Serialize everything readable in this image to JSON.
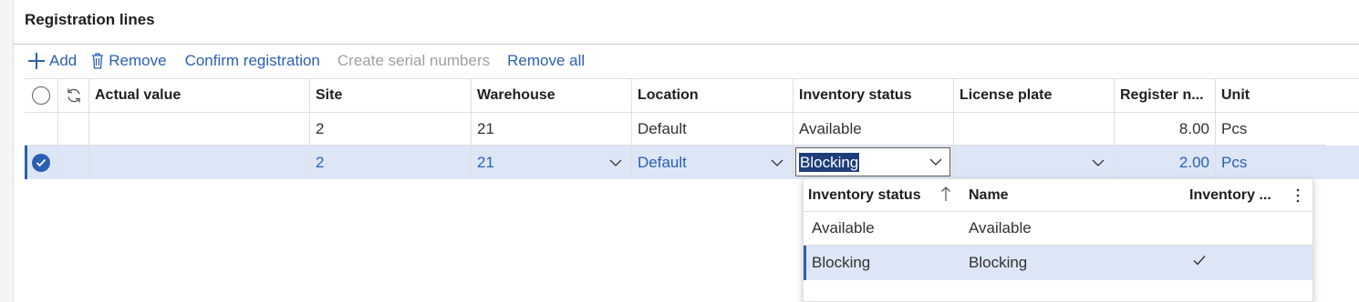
{
  "section": {
    "title": "Registration lines"
  },
  "toolbar": {
    "add": "Add",
    "remove": "Remove",
    "confirm": "Confirm registration",
    "create_serial": "Create serial numbers",
    "remove_all": "Remove all"
  },
  "grid": {
    "columns": {
      "actual_value": "Actual value",
      "site": "Site",
      "warehouse": "Warehouse",
      "location": "Location",
      "inventory_status": "Inventory status",
      "license_plate": "License plate",
      "register_now": "Register n...",
      "unit": "Unit"
    },
    "rows": [
      {
        "site": "2",
        "warehouse": "21",
        "location": "Default",
        "inventory_status": "Available",
        "license_plate": "",
        "register_now": "8.00",
        "unit": "Pcs",
        "selected": false
      },
      {
        "site": "2",
        "warehouse": "21",
        "location": "Default",
        "inventory_status": "Blocking",
        "license_plate": "",
        "register_now": "2.00",
        "unit": "Pcs",
        "selected": true
      }
    ]
  },
  "lookup": {
    "columns": {
      "status": "Inventory status",
      "name": "Name",
      "blocking": "Inventory ..."
    },
    "rows": [
      {
        "status": "Available",
        "name": "Available",
        "blocking": false
      },
      {
        "status": "Blocking",
        "name": "Blocking",
        "blocking": true
      }
    ]
  },
  "colors": {
    "accent": "#2b5fb3",
    "selected_row": "#dce6f7",
    "disabled": "#a19f9d"
  }
}
